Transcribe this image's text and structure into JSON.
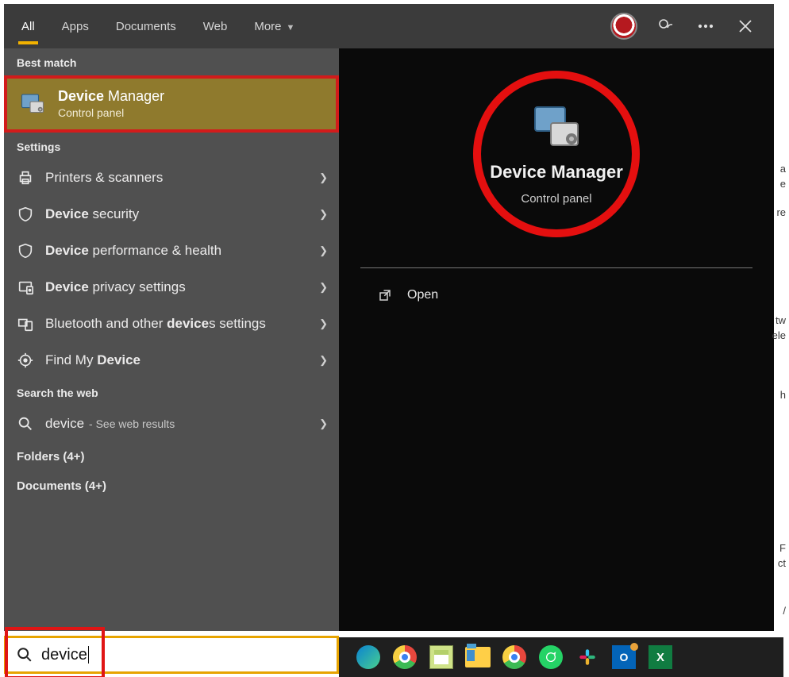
{
  "tabs": {
    "all": "All",
    "apps": "Apps",
    "documents": "Documents",
    "web": "Web",
    "more": "More"
  },
  "sections": {
    "best_match": "Best match",
    "settings": "Settings",
    "search_web": "Search the web",
    "folders": "Folders (4+)",
    "documents": "Documents (4+)"
  },
  "bestMatch": {
    "title_bold": "Device",
    "title_rest": " Manager",
    "subtitle": "Control panel"
  },
  "settingsItems": [
    {
      "label_plain": "Printers & scanners",
      "icon": "printer"
    },
    {
      "label_bold": "Device",
      "label_rest": " security",
      "icon": "shield"
    },
    {
      "label_bold": "Device",
      "label_rest": " performance & health",
      "icon": "shield"
    },
    {
      "label_bold": "Device",
      "label_rest": " privacy settings",
      "icon": "privacy"
    },
    {
      "label_pre": "Bluetooth and other ",
      "label_bold": "device",
      "label_post": "s settings",
      "icon": "bluetooth"
    },
    {
      "label_pre": "Find My ",
      "label_bold": "Device",
      "icon": "locate"
    }
  ],
  "webSearch": {
    "term": "device",
    "suffix": " - See web results"
  },
  "preview": {
    "title": "Device Manager",
    "subtitle": "Control panel"
  },
  "actions": {
    "open": "Open"
  },
  "search": {
    "value": "device"
  },
  "bgTextFragments": [
    "a",
    "e",
    "re",
    "tw",
    "ele",
    "h",
    "F",
    "ct",
    "/"
  ]
}
